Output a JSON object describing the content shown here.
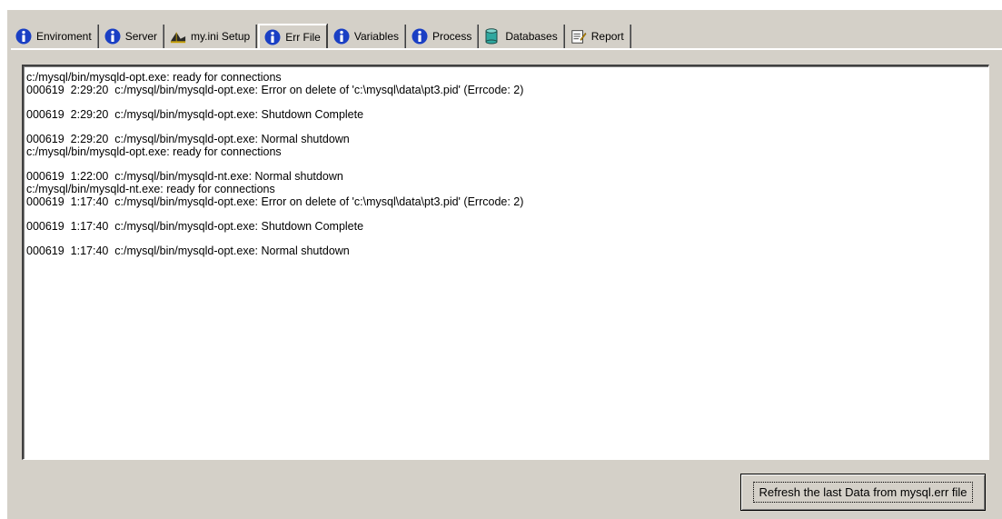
{
  "tabs": [
    {
      "label": "Enviroment",
      "icon": "info-icon"
    },
    {
      "label": "Server",
      "icon": "info-icon"
    },
    {
      "label": "my.ini Setup",
      "icon": "setup-icon"
    },
    {
      "label": "Err File",
      "icon": "info-icon",
      "active": true
    },
    {
      "label": "Variables",
      "icon": "info-icon"
    },
    {
      "label": "Process",
      "icon": "info-icon"
    },
    {
      "label": "Databases",
      "icon": "database-icon"
    },
    {
      "label": "Report",
      "icon": "report-icon"
    }
  ],
  "log_lines": [
    "c:/mysql/bin/mysqld-opt.exe: ready for connections",
    "000619  2:29:20  c:/mysql/bin/mysqld-opt.exe: Error on delete of 'c:\\mysql\\data\\pt3.pid' (Errcode: 2)",
    "",
    "000619  2:29:20  c:/mysql/bin/mysqld-opt.exe: Shutdown Complete",
    "",
    "000619  2:29:20  c:/mysql/bin/mysqld-opt.exe: Normal shutdown",
    "c:/mysql/bin/mysqld-opt.exe: ready for connections",
    "",
    "000619  1:22:00  c:/mysql/bin/mysqld-nt.exe: Normal shutdown",
    "c:/mysql/bin/mysqld-nt.exe: ready for connections",
    "000619  1:17:40  c:/mysql/bin/mysqld-opt.exe: Error on delete of 'c:\\mysql\\data\\pt3.pid' (Errcode: 2)",
    "",
    "000619  1:17:40  c:/mysql/bin/mysqld-opt.exe: Shutdown Complete",
    "",
    "000619  1:17:40  c:/mysql/bin/mysqld-opt.exe: Normal shutdown"
  ],
  "refresh_button": "Refresh the last Data from mysql.err file",
  "colors": {
    "info_icon": "#1a3fc4",
    "face": "#d4d0c8"
  }
}
